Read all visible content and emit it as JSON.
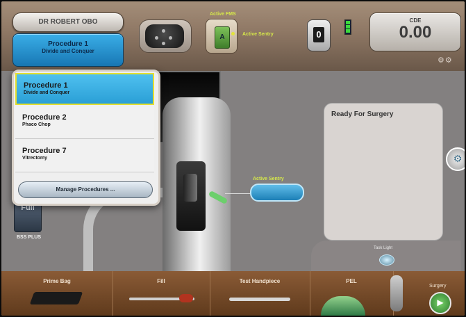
{
  "header": {
    "surgeon_name": "DR ROBERT OBO",
    "active_procedure": {
      "title": "Procedure 1",
      "subtitle": "Divide and Conquer"
    },
    "fms_label": "Active FMS",
    "fms_cassette_letter": "A",
    "sentry_label": "Active Sentry",
    "footpedal_value": "0",
    "cde": {
      "label": "CDE",
      "value": "0.00"
    }
  },
  "popup": {
    "items": [
      {
        "title": "Procedure 1",
        "subtitle": "Divide and Conquer",
        "selected": true
      },
      {
        "title": "Procedure 2",
        "subtitle": "Phaco Chop",
        "selected": false
      },
      {
        "title": "Procedure 7",
        "subtitle": "Vitrectomy",
        "selected": false
      }
    ],
    "manage_label": "Manage Procedures ..."
  },
  "main": {
    "sentry_label": "Active Sentry",
    "status_title": "Ready For Surgery",
    "fill_tile_label": "Full",
    "bss_label": "BSS PLUS",
    "tasklight_label": "Task Light"
  },
  "bottom": {
    "items": [
      "Prime Bag",
      "Fill",
      "Test Handpiece",
      "PEL"
    ],
    "surgery_label": "Surgery"
  },
  "icons": {
    "remote": "remote-control-icon",
    "pedal": "footpedal-icon",
    "gear": "gear-icon",
    "play": "play-icon"
  },
  "colors": {
    "accent_blue": "#2a9fd6",
    "highlight_yellow": "#e5df2f",
    "active_green": "#d6e84a",
    "bottom_bar": "#7a4b27"
  }
}
